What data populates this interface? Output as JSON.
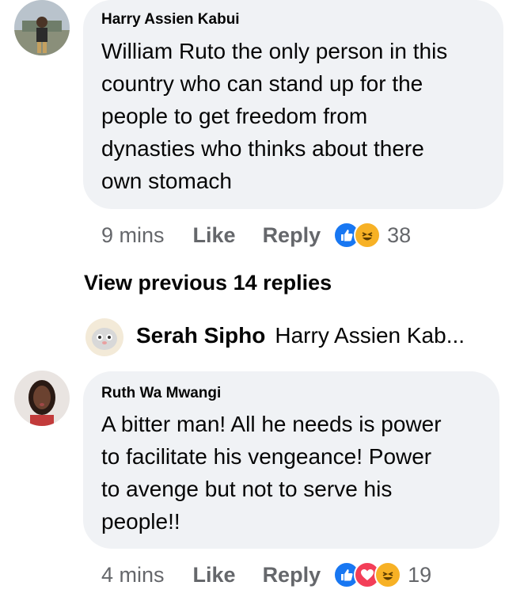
{
  "comments": [
    {
      "author": "Harry Assien Kabui",
      "text_lines": [
        "William Ruto the only person in this",
        "country who can stand up for the",
        "people to get freedom from",
        "dynasties who thinks about there",
        "own stomach"
      ],
      "time": "9 mins",
      "like_label": "Like",
      "reply_label": "Reply",
      "reactions": [
        "like-icon",
        "haha-icon"
      ],
      "reaction_count": "38"
    },
    {
      "author": "Ruth Wa Mwangi",
      "text_lines": [
        "A bitter man! All he needs is power",
        "to facilitate his vengeance! Power",
        "to avenge but not to serve his",
        "people!!"
      ],
      "time": "4 mins",
      "like_label": "Like",
      "reply_label": "Reply",
      "reactions": [
        "like-icon",
        "love-icon",
        "haha-icon"
      ],
      "reaction_count": "19"
    }
  ],
  "view_previous": "View previous 14 replies",
  "latest_reply": {
    "name": "Serah Sipho",
    "snippet": "Harry Assien Kab..."
  },
  "colors": {
    "bubble": "#f0f2f5",
    "meta_text": "#65676b",
    "like_blue": "#1877f2",
    "love_red": "#f33e58",
    "haha_yellow": "#f7b125"
  }
}
